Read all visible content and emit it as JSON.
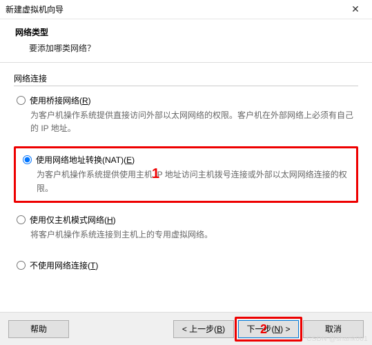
{
  "window": {
    "title": "新建虚拟机向导",
    "close_glyph": "✕"
  },
  "header": {
    "title": "网络类型",
    "subtitle": "要添加哪类网络？"
  },
  "section": {
    "label": "网络连接"
  },
  "options": {
    "bridged": {
      "label_pre": "使用桥接网络(",
      "label_key": "R",
      "label_post": ")",
      "desc": "为客户机操作系统提供直接访问外部以太网网络的权限。客户机在外部网络上必须有自己的 IP 地址。"
    },
    "nat": {
      "label_pre": "使用网络地址转换(NAT)(",
      "label_key": "E",
      "label_post": ")",
      "desc": "为客户机操作系统提供使用主机 IP 地址访问主机拨号连接或外部以太网网络连接的权限。"
    },
    "hostonly": {
      "label_pre": "使用仅主机模式网络(",
      "label_key": "H",
      "label_post": ")",
      "desc": "将客户机操作系统连接到主机上的专用虚拟网络。"
    },
    "none": {
      "label_pre": "不使用网络连接(",
      "label_key": "T",
      "label_post": ")"
    }
  },
  "annotations": {
    "one": "1",
    "two": "2"
  },
  "buttons": {
    "help": "帮助",
    "back_pre": "< 上一步(",
    "back_key": "B",
    "back_post": ")",
    "next_pre": "下一步(",
    "next_key": "N",
    "next_post": ") >",
    "cancel": "取消"
  },
  "watermark": "CSDN @shank001"
}
